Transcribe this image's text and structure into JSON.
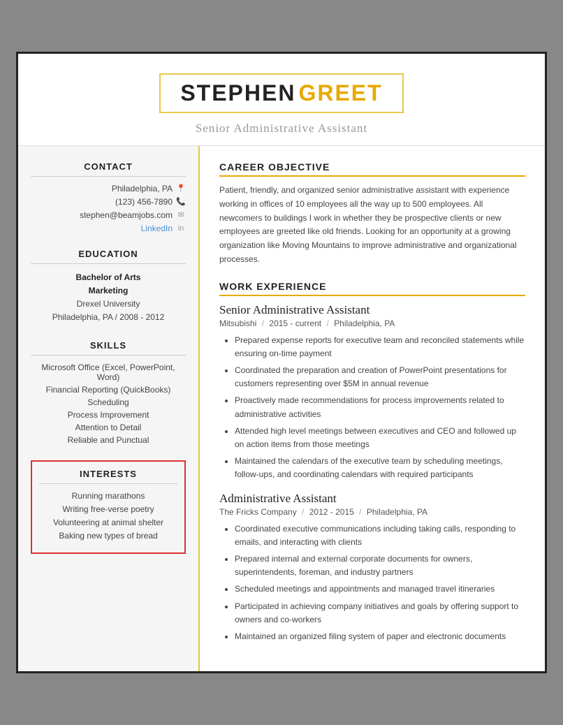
{
  "header": {
    "first_name": "STEPHEN",
    "last_name": "GREET",
    "title": "Senior Administrative Assistant"
  },
  "sidebar": {
    "contact_title": "CONTACT",
    "contact": {
      "location": "Philadelphia, PA",
      "phone": "(123) 456-7890",
      "email": "stephen@beamjobs.com",
      "linkedin_label": "LinkedIn"
    },
    "education_title": "EDUCATION",
    "education": {
      "degree": "Bachelor of Arts",
      "field": "Marketing",
      "school": "Drexel University",
      "location_year": "Philadelphia, PA  /  2008 - 2012"
    },
    "skills_title": "SKILLS",
    "skills": [
      "Microsoft Office (Excel, PowerPoint, Word)",
      "Financial Reporting (QuickBooks)",
      "Scheduling",
      "Process Improvement",
      "Attention to Detail",
      "Reliable and Punctual"
    ],
    "interests_title": "INTERESTS",
    "interests": [
      "Running marathons",
      "Writing free-verse poetry",
      "Volunteering at animal shelter",
      "Baking new types of bread"
    ]
  },
  "main": {
    "career_title": "CAREER OBJECTIVE",
    "career_text": "Patient, friendly, and organized senior administrative assistant with experience working in offices of 10 employees all the way up to 500 employees. All newcomers to buildings I work in whether they be prospective clients or new employees are greeted like old friends. Looking for an opportunity at a growing organization like Moving Mountains to improve administrative and organizational processes.",
    "work_title": "WORK EXPERIENCE",
    "jobs": [
      {
        "title": "Senior Administrative Assistant",
        "company": "Mitsubishi",
        "period": "2015 - current",
        "location": "Philadelphia, PA",
        "bullets": [
          "Prepared expense reports for executive team and reconciled statements while ensuring on-time payment",
          "Coordinated the preparation and creation of PowerPoint presentations for customers representing over $5M in annual revenue",
          "Proactively made recommendations for process improvements related to administrative activities",
          "Attended high level meetings between executives and CEO and followed up on action items from those meetings",
          "Maintained the calendars of the executive team by scheduling meetings, follow-ups, and coordinating calendars with required participants"
        ]
      },
      {
        "title": "Administrative Assistant",
        "company": "The Fricks Company",
        "period": "2012 - 2015",
        "location": "Philadelphia, PA",
        "bullets": [
          "Coordinated executive communications including taking calls, responding to emails, and interacting with clients",
          "Prepared internal and external corporate documents for owners, superintendents, foreman, and industry partners",
          "Scheduled meetings and appointments and managed travel itineraries",
          "Participated in achieving company initiatives and goals by offering support to owners and co-workers",
          "Maintained an organized filing system of paper and electronic documents"
        ]
      }
    ]
  }
}
